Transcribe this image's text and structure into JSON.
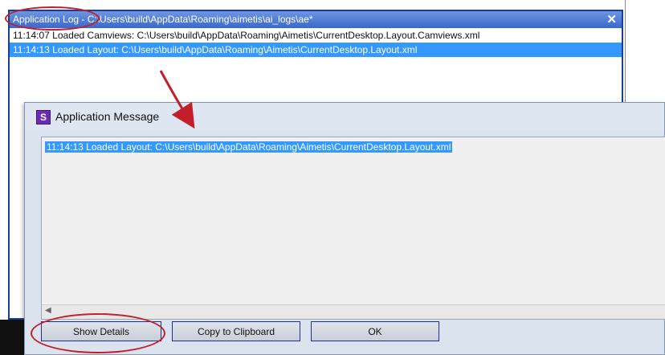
{
  "log_window": {
    "title": "Application Log - C:\\Users\\build\\AppData\\Roaming\\aimetis\\ai_logs\\ae*",
    "close_glyph": "✕",
    "rows": [
      {
        "text": "11:14:07 Loaded Camviews: C:\\Users\\build\\AppData\\Roaming\\Aimetis\\CurrentDesktop.Layout.Camviews.xml"
      },
      {
        "text": "11:14:13 Loaded Layout: C:\\Users\\build\\AppData\\Roaming\\Aimetis\\CurrentDesktop.Layout.xml"
      }
    ]
  },
  "dialog": {
    "icon_letter": "S",
    "title": "Application Message",
    "message": "11:14:13 Loaded Layout: C:\\Users\\build\\AppData\\Roaming\\Aimetis\\CurrentDesktop.Layout.xml",
    "scroll_left_glyph": "◀",
    "buttons": {
      "show_details": "Show Details",
      "copy_clipboard": "Copy to Clipboard",
      "ok": "OK"
    }
  },
  "colors": {
    "annotation": "#c21f2a",
    "selection": "#3399ff",
    "title_bar": "#3a69cc"
  }
}
